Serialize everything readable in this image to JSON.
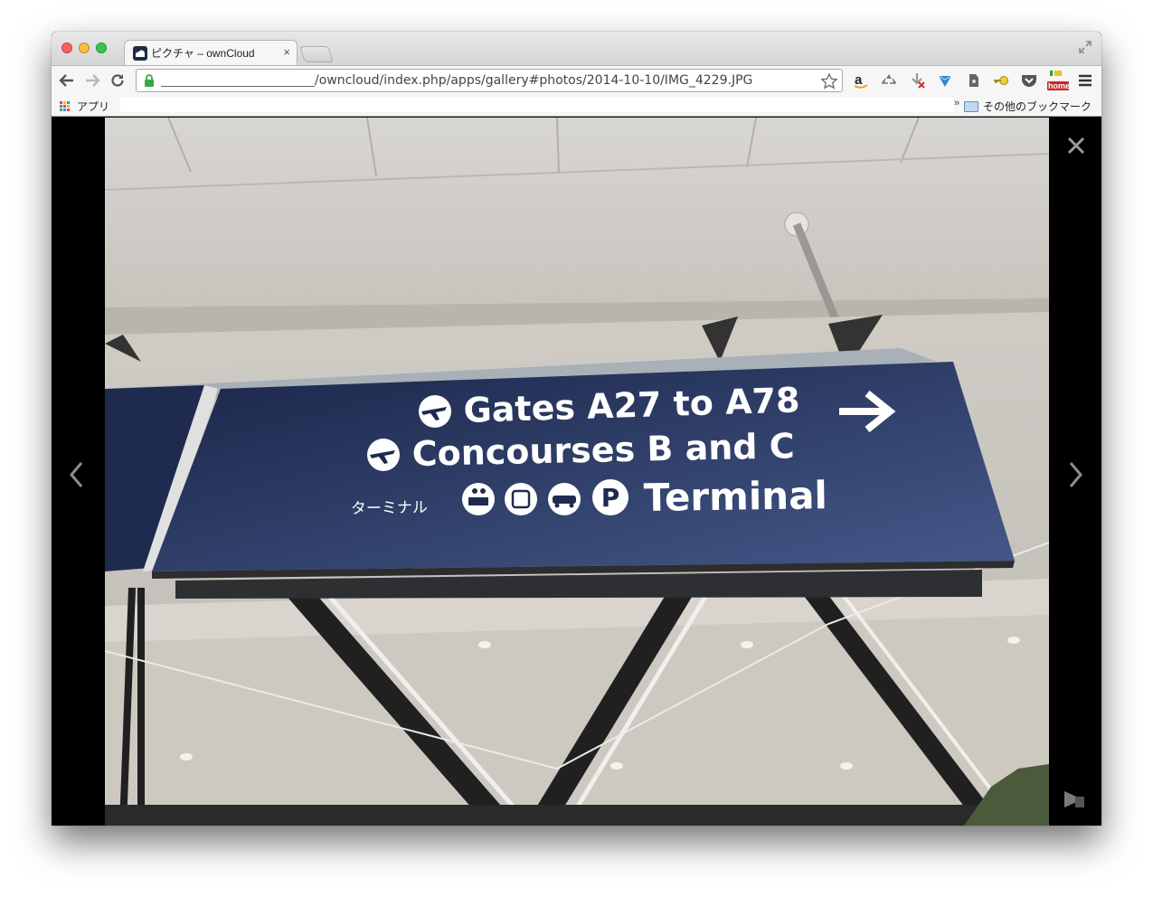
{
  "browser": {
    "tab_title": "ピクチャ – ownCloud",
    "tab_close": "×",
    "url_path": "/owncloud/index.php/apps/gallery#photos/2014-10-10/IMG_4229.JPG",
    "apps_label": "アプリ",
    "bookmarks_overflow": "»",
    "other_bookmarks_label": "その他のブックマーク",
    "extensions": [
      "amazon-icon",
      "recycle-icon",
      "download-blocked-icon",
      "heart-gem-icon",
      "evernote-icon",
      "key-icon",
      "pocket-icon",
      "home-icon",
      "menu-icon"
    ],
    "home_badge": "home"
  },
  "viewer": {
    "close_label": "✕",
    "prev_label": "‹",
    "next_label": "›",
    "sign": {
      "line1": "Gates A27 to A78",
      "line2": "Concourses B and C",
      "line3_jp": "ターミナル",
      "line3": "Terminal",
      "parking_letter": "P"
    },
    "colors": {
      "sign_blue": "#1d2b52",
      "sign_blue_light": "#3a4c7a"
    }
  }
}
